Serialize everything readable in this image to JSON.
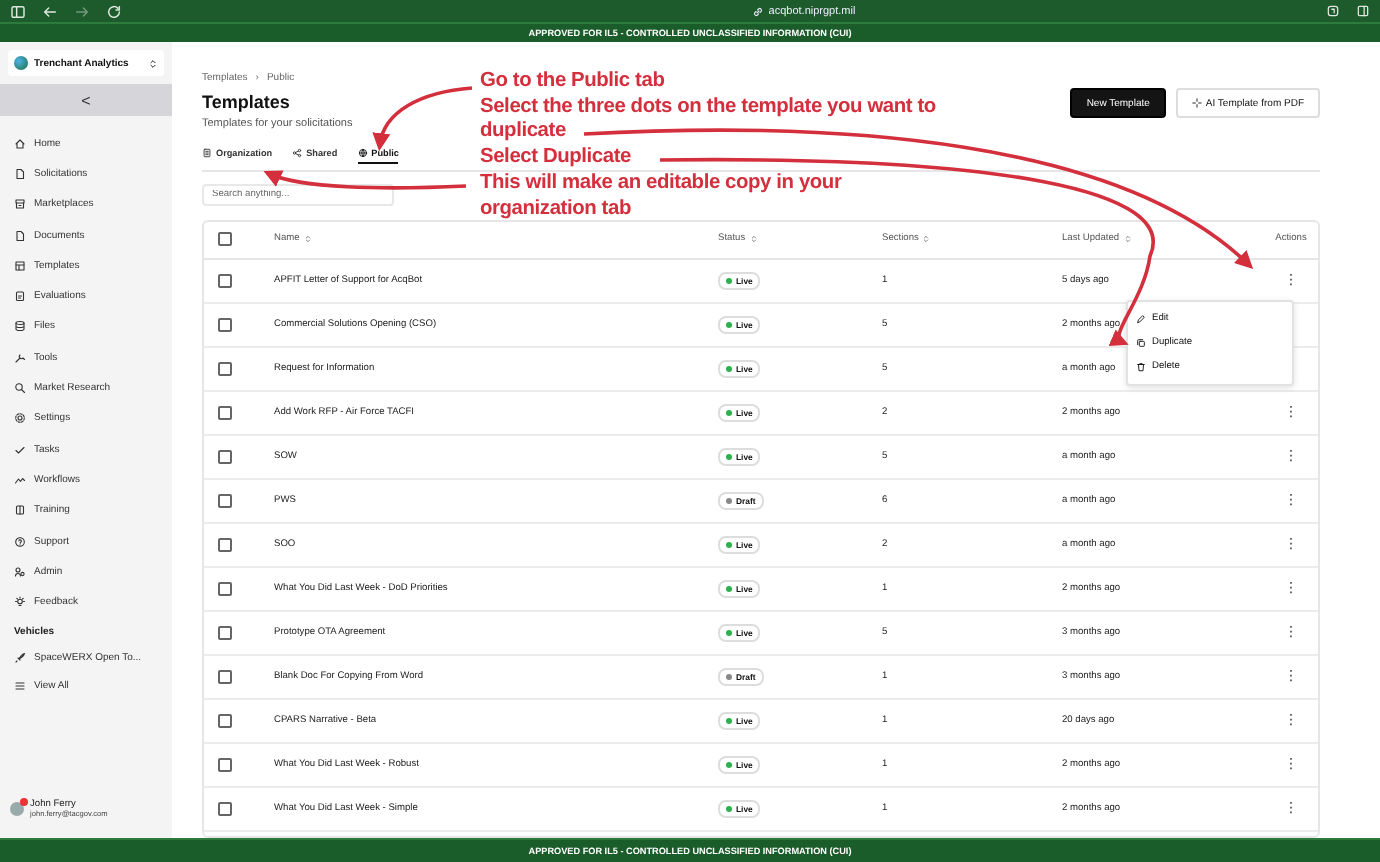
{
  "browser": {
    "url": "acqbot.niprgpt.mil"
  },
  "banner_top": "APPROVED FOR IL5 - CONTROLLED UNCLASSIFIED INFORMATION (CUI)",
  "sidebar": {
    "org": "Trenchant Analytics",
    "collapse": "<",
    "items": [
      {
        "label": "Home"
      },
      {
        "label": "Solicitations"
      },
      {
        "label": "Marketplaces"
      },
      {
        "label": "Documents"
      },
      {
        "label": "Templates"
      },
      {
        "label": "Evaluations"
      },
      {
        "label": "Files"
      },
      {
        "label": "Tools"
      },
      {
        "label": "Market Research"
      },
      {
        "label": "Settings"
      },
      {
        "label": "Tasks"
      },
      {
        "label": "Workflows"
      },
      {
        "label": "Training"
      },
      {
        "label": "Support"
      },
      {
        "label": "Admin"
      },
      {
        "label": "Feedback"
      }
    ],
    "section": "Vehicles",
    "vehicles": [
      {
        "label": "SpaceWERX Open To..."
      },
      {
        "label": "View All"
      }
    ],
    "user": {
      "name": "John Ferry",
      "email": "john.ferry@tacgov.com"
    }
  },
  "breadcrumb": {
    "items": [
      "Templates",
      "Public"
    ],
    "separator": "›"
  },
  "title": "Templates",
  "subtitle": "Templates for your solicitations",
  "buttons": [
    {
      "label": "New Template",
      "kind": "primary"
    },
    {
      "label": "AI Template from PDF",
      "kind": "secondary"
    }
  ],
  "tabs": [
    {
      "label": "Organization",
      "selected": false
    },
    {
      "label": "Shared",
      "selected": false
    },
    {
      "label": "Public",
      "selected": true
    }
  ],
  "search": {
    "placeholder": "Search anything..."
  },
  "table": {
    "select_all_checked": false,
    "columns": [
      {
        "label": "Name",
        "sortable": true
      },
      {
        "label": "Status",
        "sortable": true
      },
      {
        "label": "Sections",
        "sortable": true
      },
      {
        "label": "Last Updated",
        "sortable": true
      },
      {
        "label": "Actions",
        "sortable": false
      }
    ],
    "rows": [
      {
        "checked": false,
        "name": "APFIT Letter of Support for AcqBot",
        "status": {
          "label": "Live",
          "kind": "live"
        },
        "sections": "1",
        "updated": "5 days ago",
        "actions": "⋮"
      },
      {
        "checked": false,
        "name": "Commercial Solutions Opening (CSO)",
        "status": {
          "label": "Live",
          "kind": "live"
        },
        "sections": "5",
        "updated": "2 months ago"
      },
      {
        "checked": false,
        "name": "Request for Information",
        "status": {
          "label": "Live",
          "kind": "live"
        },
        "sections": "5",
        "updated": "a month ago"
      },
      {
        "checked": false,
        "name": "Add Work RFP - Air Force TACFI",
        "status": {
          "label": "Live",
          "kind": "live"
        },
        "sections": "2",
        "updated": "2 months ago",
        "actions": "⋮"
      },
      {
        "checked": false,
        "name": "SOW",
        "status": {
          "label": "Live",
          "kind": "live"
        },
        "sections": "5",
        "updated": "a month ago",
        "actions": "⋮"
      },
      {
        "checked": false,
        "name": "PWS",
        "status": {
          "label": "Draft",
          "kind": "draft"
        },
        "sections": "6",
        "updated": "a month ago",
        "actions": "⋮"
      },
      {
        "checked": false,
        "name": "SOO",
        "status": {
          "label": "Live",
          "kind": "live"
        },
        "sections": "2",
        "updated": "a month ago",
        "actions": "⋮"
      },
      {
        "checked": false,
        "name": "What You Did Last Week - DoD Priorities",
        "status": {
          "label": "Live",
          "kind": "live"
        },
        "sections": "1",
        "updated": "2 months ago",
        "actions": "⋮"
      },
      {
        "checked": false,
        "name": "Prototype OTA Agreement",
        "status": {
          "label": "Live",
          "kind": "live"
        },
        "sections": "5",
        "updated": "3 months ago",
        "actions": "⋮"
      },
      {
        "checked": false,
        "name": "Blank Doc For Copying From Word",
        "status": {
          "label": "Draft",
          "kind": "draft"
        },
        "sections": "1",
        "updated": "3 months ago",
        "actions": "⋮"
      },
      {
        "checked": false,
        "name": "CPARS Narrative - Beta",
        "status": {
          "label": "Live",
          "kind": "live"
        },
        "sections": "1",
        "updated": "20 days ago",
        "actions": "⋮"
      },
      {
        "checked": false,
        "name": "What You Did Last Week - Robust",
        "status": {
          "label": "Live",
          "kind": "live"
        },
        "sections": "1",
        "updated": "2 months ago",
        "actions": "⋮"
      },
      {
        "checked": false,
        "name": "What You Did Last Week - Simple",
        "status": {
          "label": "Live",
          "kind": "live"
        },
        "sections": "1",
        "updated": "2 months ago",
        "actions": "⋮"
      }
    ]
  },
  "context_menu": {
    "items": [
      {
        "label": "Edit"
      },
      {
        "label": "Duplicate"
      },
      {
        "label": "Delete"
      }
    ]
  },
  "annotations": [
    "Go to the Public tab",
    "Select the three dots on the template you want to",
    "duplicate",
    "Select Duplicate",
    "This will make an editable copy in your",
    "organization tab"
  ],
  "banner_bottom": "APPROVED FOR IL5 - CONTROLLED UNCLASSIFIED INFORMATION (CUI)"
}
